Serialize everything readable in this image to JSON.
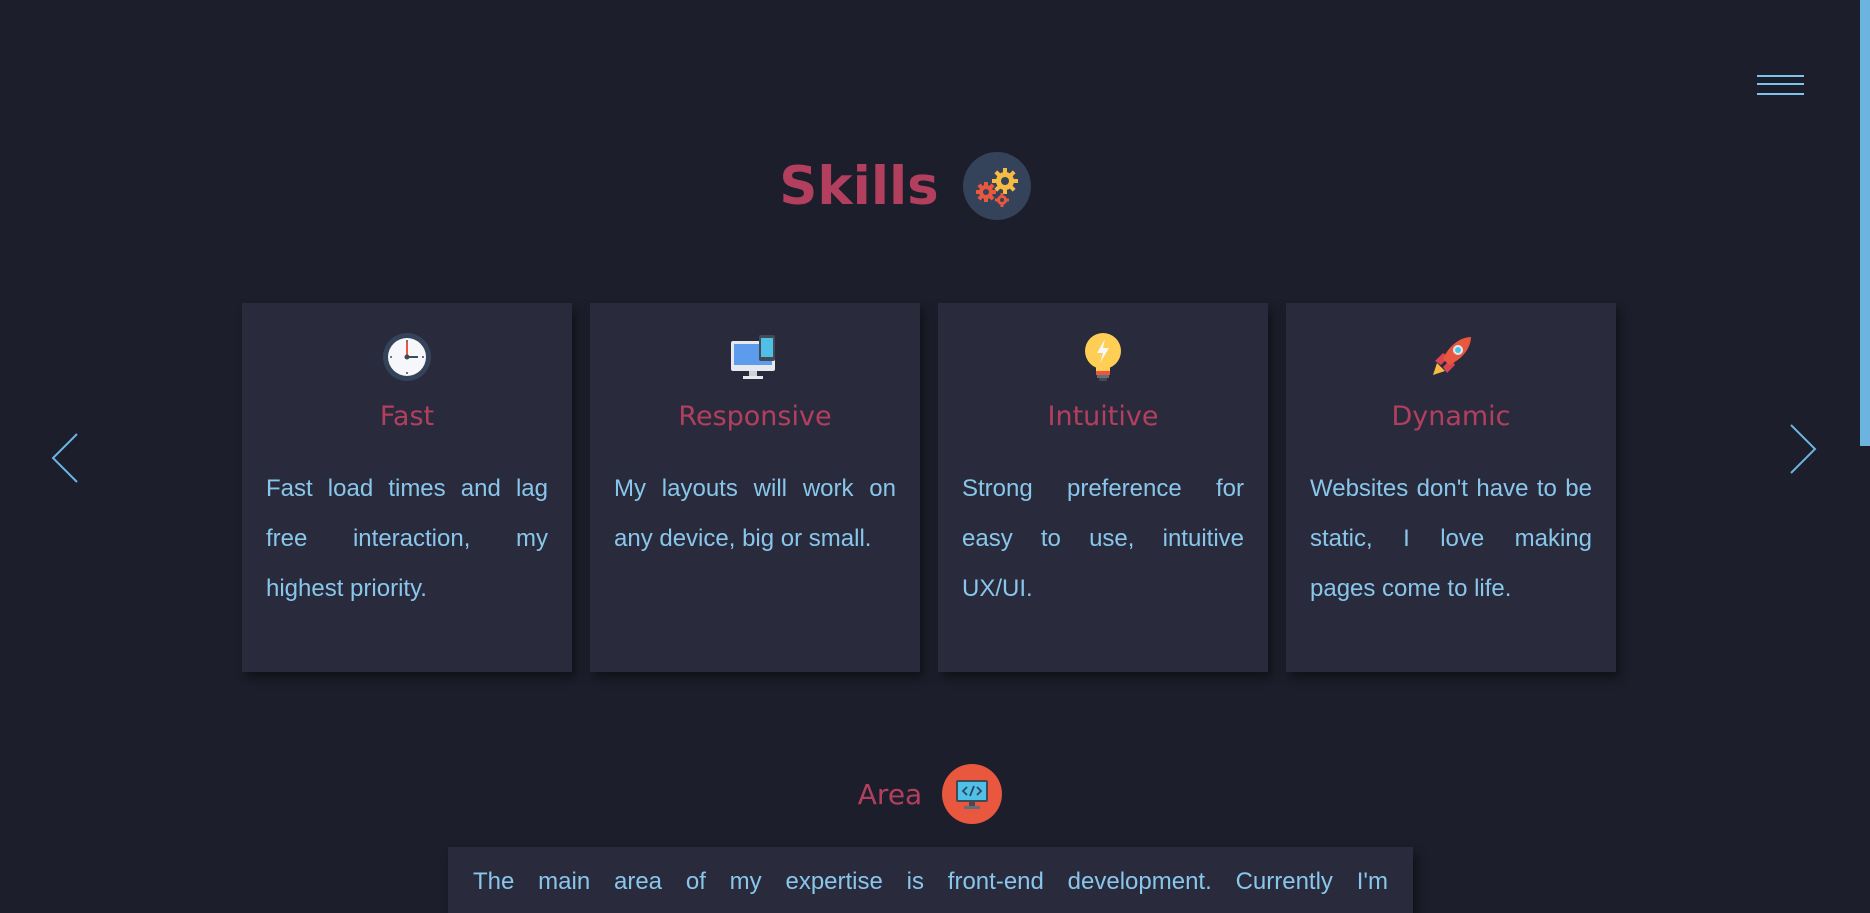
{
  "nav": {
    "menu_icon": "hamburger-menu-icon"
  },
  "skills": {
    "title": "Skills",
    "title_icon": "gears-icon",
    "cards": [
      {
        "icon": "clock-icon",
        "title": "Fast",
        "text": "Fast load times and lag free interaction, my highest priority."
      },
      {
        "icon": "devices-icon",
        "title": "Responsive",
        "text": "My layouts will work on any device, big or small."
      },
      {
        "icon": "lightbulb-icon",
        "title": "Intuitive",
        "text": "Strong preference for easy to use, intuitive UX/UI."
      },
      {
        "icon": "rocket-icon",
        "title": "Dynamic",
        "text": "Websites don't have to be static, I love making pages come to life."
      }
    ],
    "prev_icon": "chevron-left-icon",
    "next_icon": "chevron-right-icon"
  },
  "area": {
    "title": "Area",
    "icon": "code-monitor-icon",
    "text": "The main area of my expertise is front-end development. Currently I'm"
  },
  "colors": {
    "background": "#1c1e2b",
    "card": "#292b3c",
    "accent_title": "#b33f5e",
    "body_text": "#89c6eb",
    "scrollbar": "#6cb4e0"
  }
}
